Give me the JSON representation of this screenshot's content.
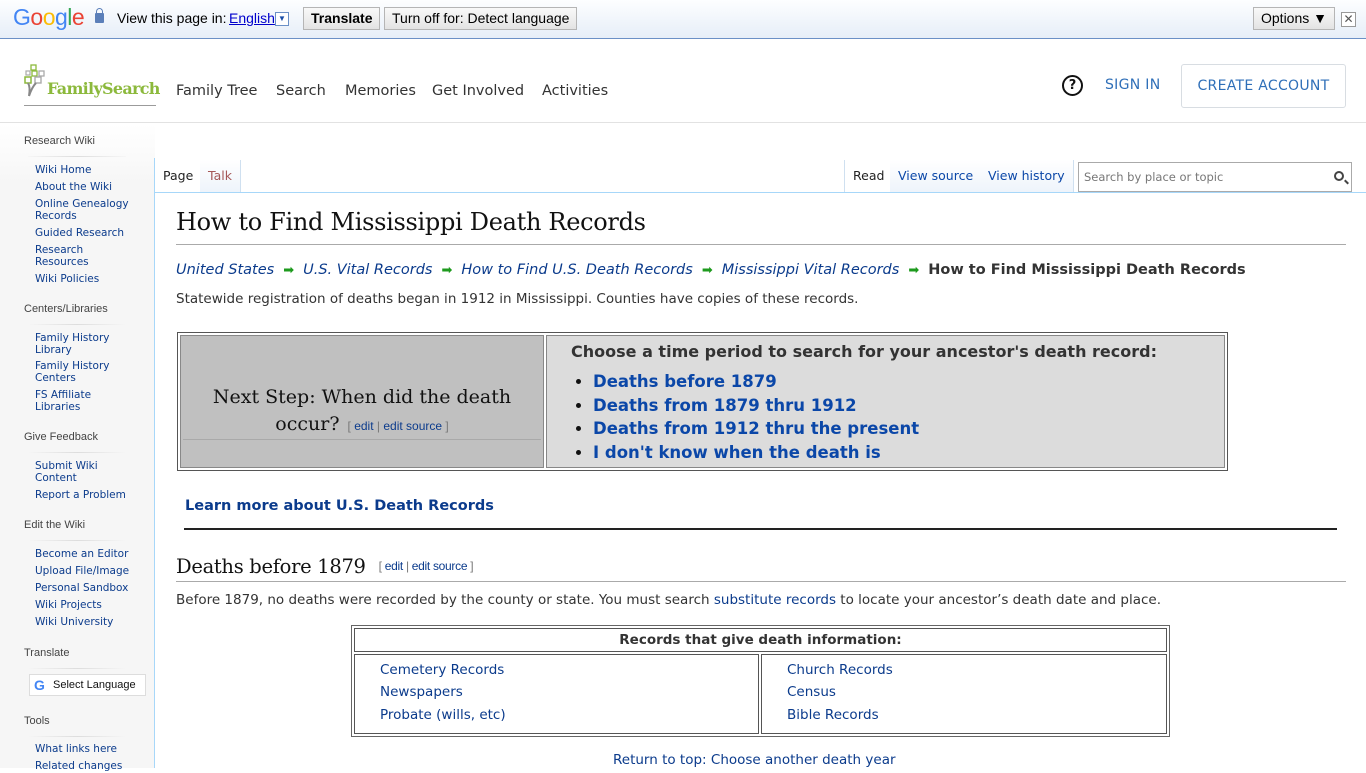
{
  "translate_bar": {
    "brand": [
      "G",
      "o",
      "o",
      "g",
      "l",
      "e"
    ],
    "view_in_label": "View this page in:",
    "language": "English",
    "language_dropdown_glyph": "▼",
    "translate_button": "Translate",
    "turn_off_button": "Turn off for: Detect language",
    "options_button": "Options ▼",
    "close_glyph": "✕"
  },
  "header": {
    "logo_text": "FamilySearch",
    "nav": [
      "Family Tree",
      "Search",
      "Memories",
      "Get Involved",
      "Activities"
    ],
    "help_glyph": "?",
    "sign_in": "SIGN IN",
    "create_account": "CREATE ACCOUNT"
  },
  "sidebar": {
    "sections": [
      {
        "heading": "Research Wiki",
        "items": [
          "Wiki Home",
          "About the Wiki",
          "Online Genealogy Records",
          "Guided Research",
          "Research Resources",
          "Wiki Policies"
        ]
      },
      {
        "heading": "Centers/Libraries",
        "items": [
          "Family History Library",
          "Family History Centers",
          "FS Affiliate Libraries"
        ]
      },
      {
        "heading": "Give Feedback",
        "items": [
          "Submit Wiki Content",
          "Report a Problem"
        ]
      },
      {
        "heading": "Edit the Wiki",
        "items": [
          "Become an Editor",
          "Upload File/Image",
          "Personal Sandbox",
          "Wiki Projects",
          "Wiki University"
        ]
      },
      {
        "heading": "Translate",
        "items": []
      },
      {
        "heading": "Tools",
        "items": [
          "What links here",
          "Related changes"
        ]
      }
    ],
    "select_language": "Select Language"
  },
  "tabs": {
    "left": [
      {
        "label": "Page",
        "selected": true
      },
      {
        "label": "Talk",
        "selected": false
      }
    ],
    "right": [
      {
        "label": "Read",
        "selected": true
      },
      {
        "label": "View source",
        "selected": false
      },
      {
        "label": "View history",
        "selected": false
      }
    ],
    "search_placeholder": "Search by place or topic"
  },
  "article": {
    "title": "How to Find Mississippi Death Records",
    "breadcrumbs": [
      "United States",
      "U.S. Vital Records",
      "How to Find U.S. Death Records",
      "Mississippi Vital Records"
    ],
    "breadcrumb_current": "How to Find Mississippi Death Records",
    "breadcrumb_arrow": "➡",
    "intro": "Statewide registration of deaths began in 1912 in Mississippi. Counties have copies of these records.",
    "next_step": {
      "title": "Next Step: When did the death occur?",
      "edit": "edit",
      "edit_source": "edit source",
      "choose_label": "Choose a time period to search for your ancestor's death record:",
      "options": [
        "Deaths before 1879",
        "Deaths from 1879 thru 1912",
        "Deaths from 1912 thru the present",
        "I don't know when the death is"
      ]
    },
    "learn_more": "Learn more about U.S. Death Records",
    "section": {
      "heading": "Deaths before 1879",
      "edit": "edit",
      "edit_source": "edit source",
      "para_before": "Before 1879, no deaths were recorded by the county or state. You must search ",
      "para_link": "substitute records",
      "para_after": " to locate your ancestor’s death date and place.",
      "table_header": "Records that give death information:",
      "left_links": [
        "Cemetery Records",
        "Newspapers",
        "Probate (wills, etc)"
      ],
      "right_links": [
        "Church Records",
        "Census",
        "Bible Records"
      ],
      "return_top": "Return to top: Choose another death year"
    }
  }
}
